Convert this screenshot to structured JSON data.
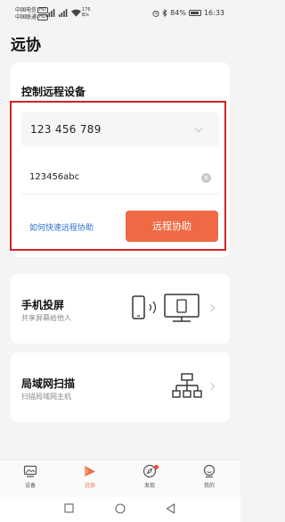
{
  "status_bar": {
    "carrier1": "中国电信",
    "carrier2": "中国联通",
    "hd_badge": "HD",
    "net_speed_value": "176",
    "net_speed_unit": "B/s",
    "battery": "84%",
    "time": "16:33"
  },
  "page": {
    "title": "远协"
  },
  "remote_card": {
    "title": "控制远程设备",
    "device_id": "123 456 789",
    "password": "123456abc",
    "help_link": "如何快速远程协助",
    "action_button": "远程协助"
  },
  "features": [
    {
      "title": "手机投屏",
      "subtitle": "共享屏幕给他人",
      "icon": "phone-cast-icon"
    },
    {
      "title": "局域网扫描",
      "subtitle": "扫描局域网主机",
      "icon": "network-topology-icon"
    }
  ],
  "tabs": [
    {
      "label": "设备",
      "icon": "device-icon",
      "active": false
    },
    {
      "label": "远协",
      "icon": "remote-assist-icon",
      "active": true
    },
    {
      "label": "发现",
      "icon": "compass-icon",
      "active": false,
      "badge": true
    },
    {
      "label": "我的",
      "icon": "profile-icon",
      "active": false
    }
  ],
  "colors": {
    "accent": "#ef6a44",
    "link": "#2f6fd0",
    "highlight_border": "#d42222"
  }
}
